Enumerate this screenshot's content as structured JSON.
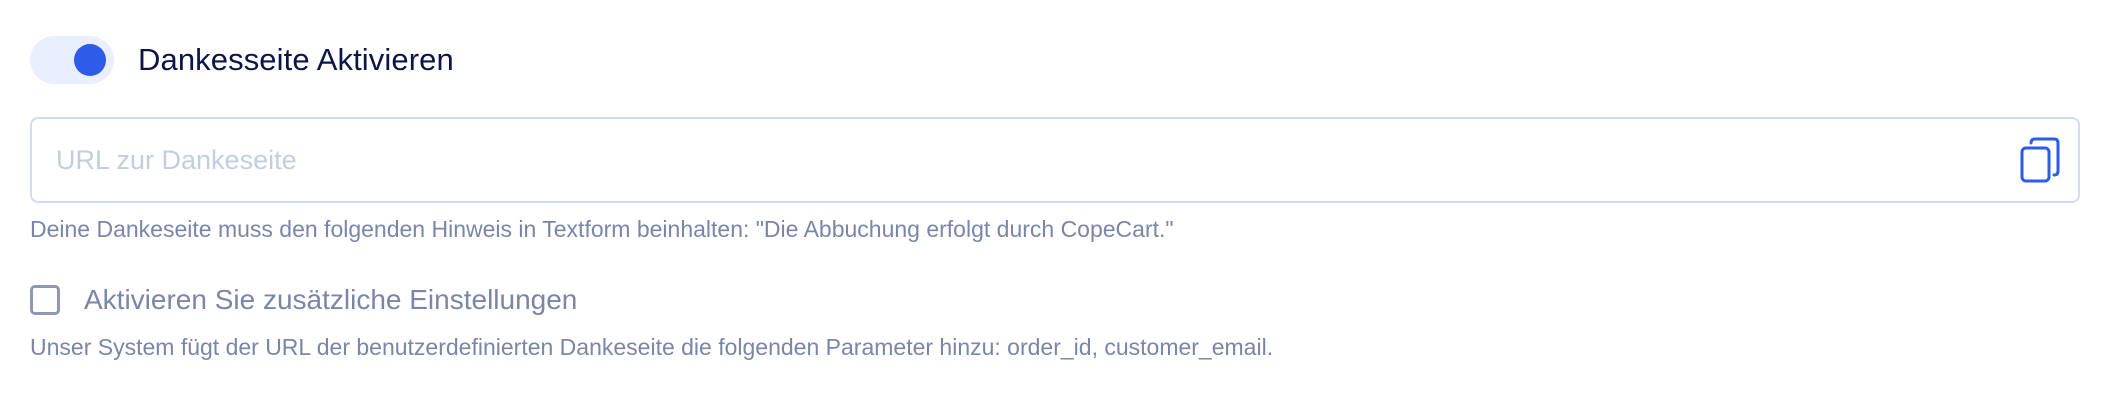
{
  "toggle": {
    "label": "Dankesseite Aktivieren",
    "enabled": true,
    "accent_color": "#2f5bea",
    "track_color": "#e9effe"
  },
  "url_field": {
    "value": "",
    "placeholder": "URL zur Dankeseite",
    "action_icon": "copy-icon"
  },
  "hint_text": "Deine Dankeseite muss den folgenden Hinweis in Textform beinhalten: \"Die Abbuchung erfolgt durch CopeCart.\"",
  "extra_settings": {
    "label": "Aktivieren Sie zusätzliche Einstellungen",
    "checked": false
  },
  "params_text": "Unser System fügt der URL der benutzerdefinierten Dankeseite die folgenden Parameter hinzu: order_id, customer_email."
}
